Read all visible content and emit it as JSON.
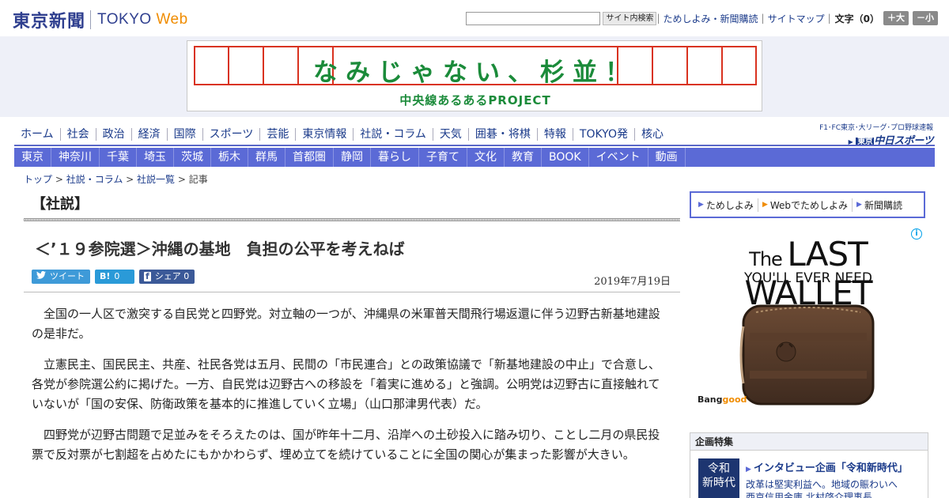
{
  "header": {
    "logo_jp": "東京新聞",
    "logo_en_a": "TOKYO ",
    "logo_en_b": "Web",
    "search_button": "サイト内検索",
    "links": [
      "ためしよみ・新聞購読",
      "サイトマップ"
    ],
    "font_size_label": "文字（0）",
    "font_bigger": "＋大",
    "font_smaller": "－小"
  },
  "banner": {
    "title": "なみじゃない、杉並！",
    "subtitle": "中央線あるあるPROJECT",
    "accent_color": "#d9321f",
    "text_color": "#1b8b3a"
  },
  "main_nav": [
    "ホーム",
    "社会",
    "政治",
    "経済",
    "国際",
    "スポーツ",
    "芸能",
    "東京情報",
    "社説・コラム",
    "天気",
    "囲碁・将棋",
    "特報",
    "TOKYO発",
    "核心"
  ],
  "chunichi": {
    "top": "F1･FC東京･大リーグ･プロ野球速報",
    "box": "東京",
    "logo": "中日スポーツ"
  },
  "sub_nav": [
    "東京",
    "神奈川",
    "千葉",
    "埼玉",
    "茨城",
    "栃木",
    "群馬",
    "首都圏",
    "静岡",
    "暮らし",
    "子育て",
    "文化",
    "教育",
    "BOOK",
    "イベント",
    "動画"
  ],
  "breadcrumb": {
    "items": [
      "トップ",
      "社説・コラム",
      "社説一覧"
    ],
    "current": "記事",
    "separator": " > "
  },
  "article": {
    "section": "【社説】",
    "headline": "＜’１９参院選＞沖縄の基地　負担の公平を考えねば",
    "date": "2019年7月19日",
    "paragraphs": [
      "全国の一人区で激突する自民党と四野党。対立軸の一つが、沖縄県の米軍普天間飛行場返還に伴う辺野古新基地建設の是非だ。",
      "立憲民主、国民民主、共産、社民各党は五月、民間の「市民連合」との政策協議で「新基地建設の中止」で合意し、各党が参院選公約に掲げた。一方、自民党は辺野古への移設を「着実に進める」と強調。公明党は辺野古に直接触れていないが「国の安保、防衛政策を基本的に推進していく立場」（山口那津男代表）だ。",
      "四野党が辺野古問題で足並みをそろえたのは、国が昨年十二月、沿岸への土砂投入に踏み切り、ことし二月の県民投票で反対票が七割超を占めたにもかかわらず、埋め立てを続けていることに全国の関心が集まった影響が大きい。"
    ]
  },
  "social": {
    "tweet": "ツイート",
    "hatena_icon": "B!",
    "hatena_count": "0",
    "fb_icon": "f",
    "fb_label": "シェア",
    "fb_count": "0"
  },
  "subscribe": {
    "items": [
      "ためしよみ",
      "Webでためしよみ",
      "新聞購読"
    ]
  },
  "ad": {
    "title_pre": "The ",
    "title_main": "LAST WALLET",
    "subtitle": "YOU'LL EVER NEED",
    "brand_a": "Bang",
    "brand_b": "good",
    "info": "i"
  },
  "kikaku": {
    "header": "企画特集",
    "thumb_line1": "令和",
    "thumb_line2": "新時代",
    "title": "インタビュー企画「令和新時代」",
    "desc_line1": "改革は堅実利益へ。地域の賑わいへ",
    "desc_line2": "西京信用金庫 北村啓介理事長"
  }
}
